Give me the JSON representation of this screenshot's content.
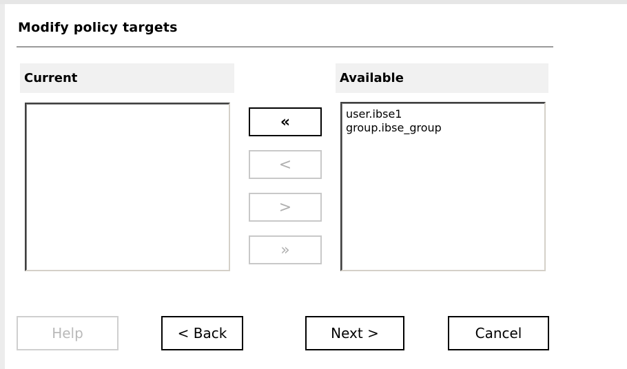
{
  "dialog": {
    "title": "Modify policy targets"
  },
  "current": {
    "header": "Current",
    "items": []
  },
  "available": {
    "header": "Available",
    "items": [
      "user.ibse1",
      "group.ibse_group"
    ]
  },
  "move_buttons": {
    "add_all": "«",
    "add_one": "<",
    "remove_one": ">",
    "remove_all": "»"
  },
  "footer": {
    "help": "Help",
    "back": "< Back",
    "next": "Next >",
    "cancel": "Cancel"
  }
}
